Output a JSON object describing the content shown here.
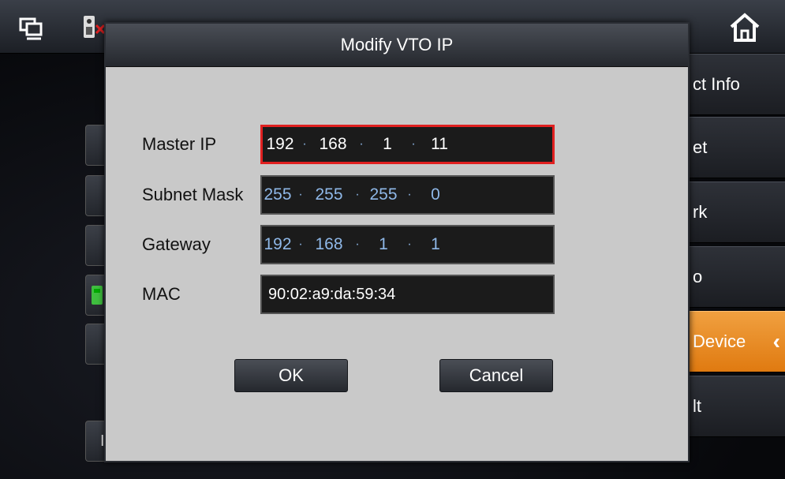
{
  "modal": {
    "title": "Modify VTO IP",
    "fields": {
      "master_ip": {
        "label": "Master IP",
        "octets": [
          "192",
          "168",
          "1",
          "11"
        ]
      },
      "subnet_mask": {
        "label": "Subnet Mask",
        "octets": [
          "255",
          "255",
          "255",
          "0"
        ]
      },
      "gateway": {
        "label": "Gateway",
        "octets": [
          "192",
          "168",
          "1",
          "1"
        ]
      },
      "mac": {
        "label": "MAC",
        "value": "90:02:a9:da:59:34"
      }
    },
    "ok_label": "OK",
    "cancel_label": "Cancel"
  },
  "right_menu": {
    "items": [
      {
        "label": "ct Info"
      },
      {
        "label": "et"
      },
      {
        "label": "rk"
      },
      {
        "label": "o"
      },
      {
        "label": "Device",
        "chevron": "‹"
      },
      {
        "label": "lt"
      }
    ]
  },
  "left_stub_text": "I",
  "colors": {
    "accent": "#e8891e",
    "focus_border": "#e02020",
    "readonly_value": "#8fb8e8"
  }
}
